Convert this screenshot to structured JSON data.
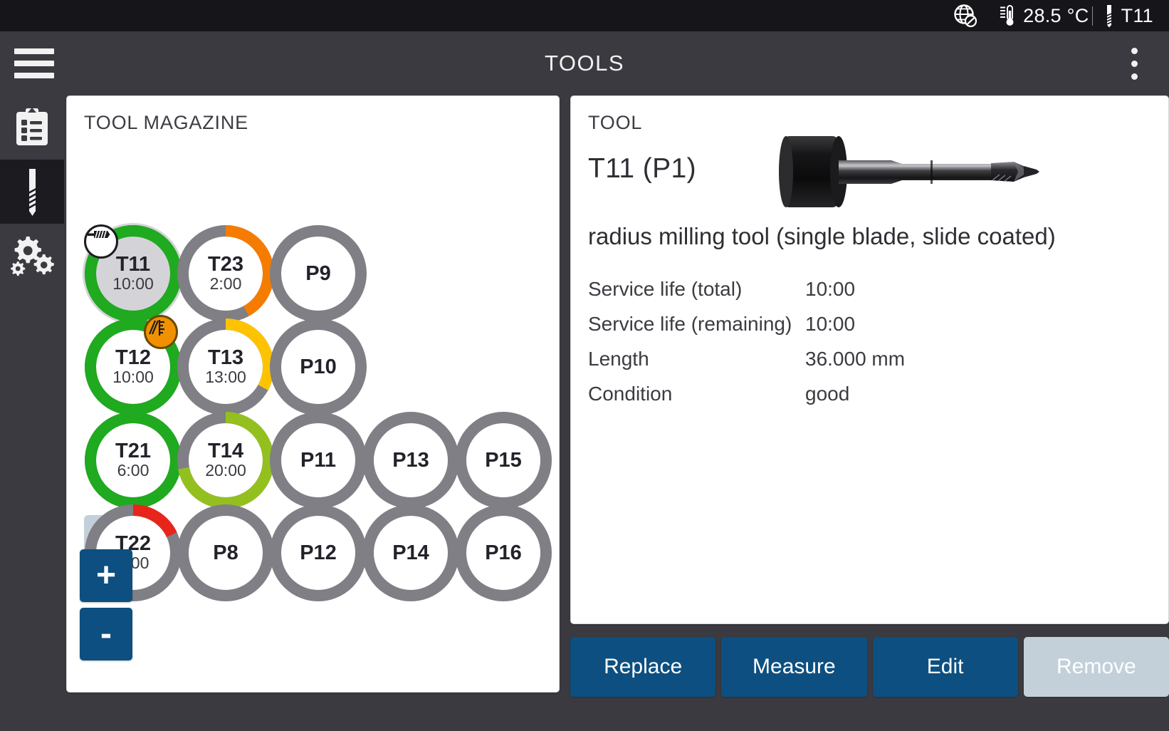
{
  "statusbar": {
    "network_icon": "globe-disconnected-icon",
    "temperature_icon": "thermometer-icon",
    "temperature": "28.5 °C",
    "tool_icon": "drill-bit-icon",
    "active_tool": "T11"
  },
  "titlebar": {
    "menu_icon": "hamburger-menu-icon",
    "title": "TOOLS",
    "overflow_icon": "kebab-menu-icon"
  },
  "sidebar": {
    "items": [
      {
        "icon": "clipboard-list-icon",
        "name": "sidebar-item-program",
        "active": false
      },
      {
        "icon": "drill-bit-icon",
        "name": "sidebar-item-tools",
        "active": true
      },
      {
        "icon": "gears-icon",
        "name": "sidebar-item-settings",
        "active": false
      }
    ]
  },
  "magazine": {
    "heading": "TOOL MAGAZINE",
    "add_label": "+",
    "remove_label": "-",
    "slots": [
      {
        "id": "T11",
        "label": "T11",
        "time": "10:00",
        "type": "tool",
        "ring_color": "#1faa1f",
        "ring_pct": 100,
        "track_color": "#7f7f85",
        "selected": true,
        "halo": true,
        "inner_fill": "#d4d4d8",
        "badge": "mill-tool-icon",
        "badge_style": "white",
        "col": 0,
        "row": 0
      },
      {
        "id": "T23",
        "label": "T23",
        "time": "2:00",
        "type": "tool",
        "ring_color": "#f57c00",
        "ring_pct": 42,
        "track_color": "#7f7f85",
        "selected": false,
        "halo": false,
        "inner_fill": "#ffffff",
        "badge": null,
        "badge_style": null,
        "col": 1,
        "row": 0
      },
      {
        "id": "P9",
        "label": "P9",
        "time": "",
        "type": "pocket",
        "ring_color": null,
        "ring_pct": 0,
        "track_color": "#7f7f85",
        "selected": false,
        "halo": false,
        "inner_fill": "#ffffff",
        "badge": null,
        "badge_style": null,
        "col": 2,
        "row": 0
      },
      {
        "id": "T12",
        "label": "T12",
        "time": "10:00",
        "type": "tool",
        "ring_color": "#1faa1f",
        "ring_pct": 100,
        "track_color": "#7f7f85",
        "selected": false,
        "halo": false,
        "inner_fill": "#ffffff",
        "badge": "gauge-icon",
        "badge_style": "orange",
        "col": 0,
        "row": 1
      },
      {
        "id": "T13",
        "label": "T13",
        "time": "13:00",
        "type": "tool",
        "ring_color": "#fdc300",
        "ring_pct": 33,
        "track_color": "#7f7f85",
        "selected": false,
        "halo": false,
        "inner_fill": "#ffffff",
        "badge": null,
        "badge_style": null,
        "col": 1,
        "row": 1
      },
      {
        "id": "P10",
        "label": "P10",
        "time": "",
        "type": "pocket",
        "ring_color": null,
        "ring_pct": 0,
        "track_color": "#7f7f85",
        "selected": false,
        "halo": false,
        "inner_fill": "#ffffff",
        "badge": null,
        "badge_style": null,
        "col": 2,
        "row": 1
      },
      {
        "id": "T21",
        "label": "T21",
        "time": "6:00",
        "type": "tool",
        "ring_color": "#1faa1f",
        "ring_pct": 100,
        "track_color": "#7f7f85",
        "selected": false,
        "halo": false,
        "inner_fill": "#ffffff",
        "badge": null,
        "badge_style": null,
        "col": 0,
        "row": 2
      },
      {
        "id": "T14",
        "label": "T14",
        "time": "20:00",
        "type": "tool",
        "ring_color": "#93c01f",
        "ring_pct": 72,
        "track_color": "#7f7f85",
        "selected": false,
        "halo": false,
        "inner_fill": "#ffffff",
        "badge": null,
        "badge_style": null,
        "col": 1,
        "row": 2
      },
      {
        "id": "P11",
        "label": "P11",
        "time": "",
        "type": "pocket",
        "ring_color": null,
        "ring_pct": 0,
        "track_color": "#7f7f85",
        "selected": false,
        "halo": false,
        "inner_fill": "#ffffff",
        "badge": null,
        "badge_style": null,
        "col": 2,
        "row": 2
      },
      {
        "id": "P13",
        "label": "P13",
        "time": "",
        "type": "pocket",
        "ring_color": null,
        "ring_pct": 0,
        "track_color": "#7f7f85",
        "selected": false,
        "halo": false,
        "inner_fill": "#ffffff",
        "badge": null,
        "badge_style": null,
        "col": 3,
        "row": 2
      },
      {
        "id": "P15",
        "label": "P15",
        "time": "",
        "type": "pocket",
        "ring_color": null,
        "ring_pct": 0,
        "track_color": "#7f7f85",
        "selected": false,
        "halo": false,
        "inner_fill": "#ffffff",
        "badge": null,
        "badge_style": null,
        "col": 4,
        "row": 2
      },
      {
        "id": "T22",
        "label": "T22",
        "time": "1:00",
        "type": "tool",
        "ring_color": "#e8251a",
        "ring_pct": 18,
        "track_color": "#7f7f85",
        "selected": false,
        "halo": false,
        "inner_fill": "#ffffff",
        "badge": null,
        "badge_style": null,
        "col": 0,
        "row": 3
      },
      {
        "id": "P8",
        "label": "P8",
        "time": "",
        "type": "pocket",
        "ring_color": null,
        "ring_pct": 0,
        "track_color": "#7f7f85",
        "selected": false,
        "halo": false,
        "inner_fill": "#ffffff",
        "badge": null,
        "badge_style": null,
        "col": 1,
        "row": 3
      },
      {
        "id": "P12",
        "label": "P12",
        "time": "",
        "type": "pocket",
        "ring_color": null,
        "ring_pct": 0,
        "track_color": "#7f7f85",
        "selected": false,
        "halo": false,
        "inner_fill": "#ffffff",
        "badge": null,
        "badge_style": null,
        "col": 2,
        "row": 3
      },
      {
        "id": "P14",
        "label": "P14",
        "time": "",
        "type": "pocket",
        "ring_color": null,
        "ring_pct": 0,
        "track_color": "#7f7f85",
        "selected": false,
        "halo": false,
        "inner_fill": "#ffffff",
        "badge": null,
        "badge_style": null,
        "col": 3,
        "row": 3
      },
      {
        "id": "P16",
        "label": "P16",
        "time": "",
        "type": "pocket",
        "ring_color": null,
        "ring_pct": 0,
        "track_color": "#7f7f85",
        "selected": false,
        "halo": false,
        "inner_fill": "#ffffff",
        "badge": null,
        "badge_style": null,
        "col": 4,
        "row": 3
      }
    ]
  },
  "tool": {
    "heading": "TOOL",
    "title": "T11 (P1)",
    "description": "radius milling tool (single blade, slide coated)",
    "photo_icon": "milling-tool-photo",
    "properties": [
      {
        "key": "Service life (total)",
        "value": "10:00"
      },
      {
        "key": "Service life (remaining)",
        "value": "10:00"
      },
      {
        "key": "Length",
        "value": "36.000 mm"
      },
      {
        "key": "Condition",
        "value": "good"
      }
    ]
  },
  "actions": [
    {
      "label": "Replace",
      "name": "replace-button",
      "disabled": false
    },
    {
      "label": "Measure",
      "name": "measure-button",
      "disabled": false
    },
    {
      "label": "Edit",
      "name": "edit-button",
      "disabled": false
    },
    {
      "label": "Remove",
      "name": "remove-button",
      "disabled": true
    }
  ],
  "colors": {
    "accent": "#0d4f80",
    "chrome": "#3a3a40",
    "status_bar": "#16161a",
    "ring_track": "#7f7f85",
    "ok": "#1faa1f",
    "warn_yellow": "#fdc300",
    "warn_orange": "#f57c00",
    "alarm": "#e8251a",
    "lime": "#93c01f",
    "disabled": "#c3d0da"
  }
}
